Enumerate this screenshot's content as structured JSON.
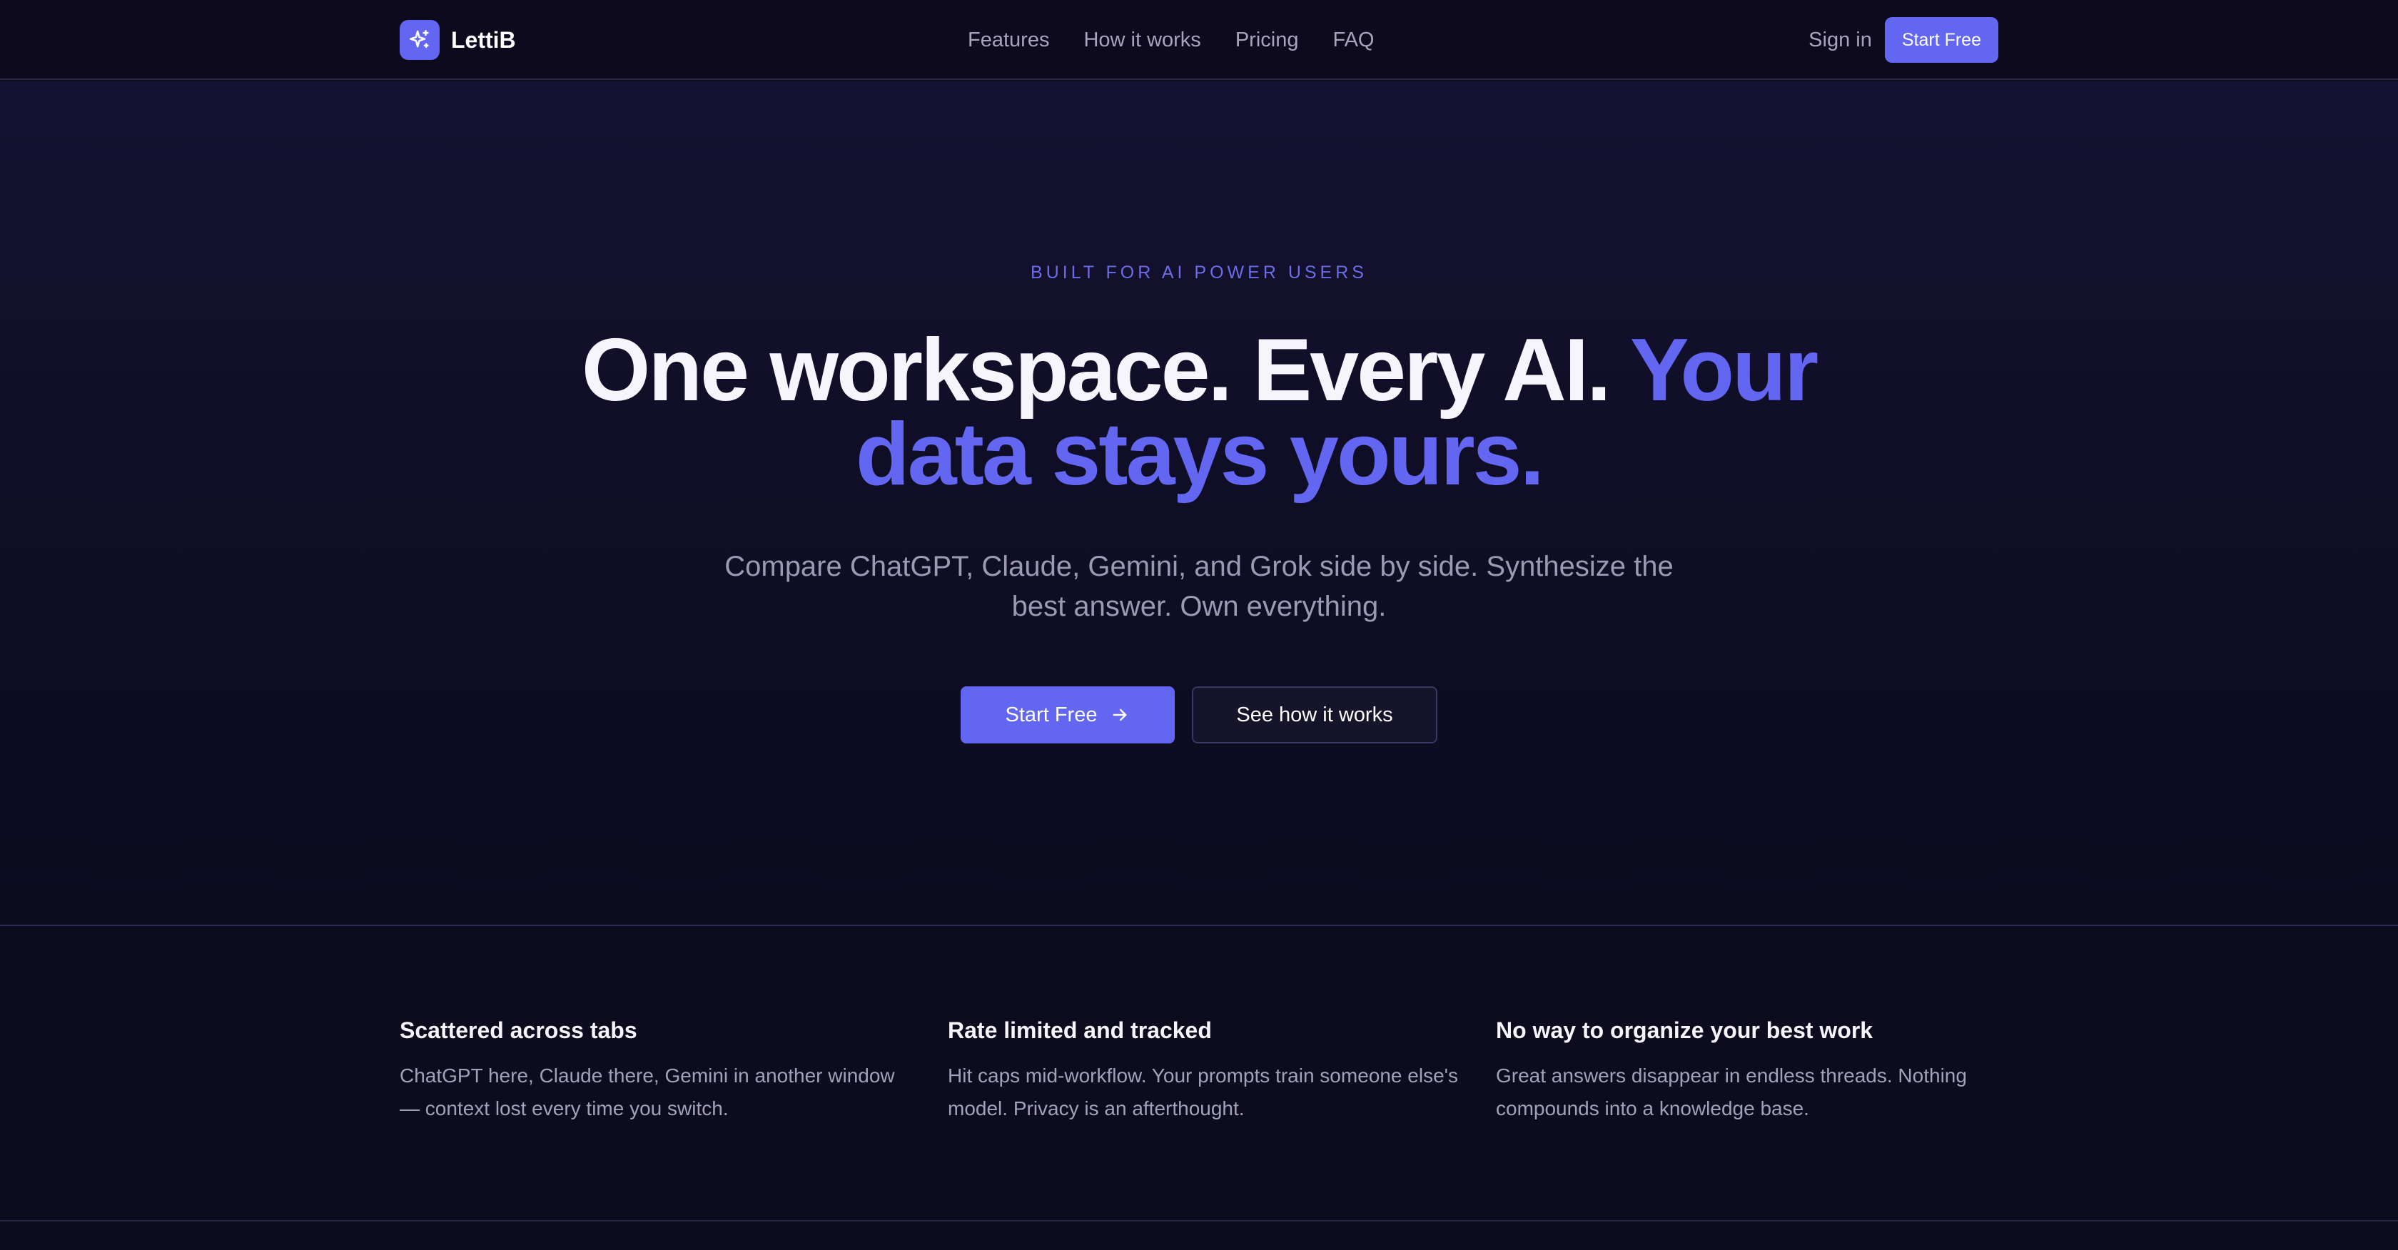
{
  "nav": {
    "brand": "LettiB",
    "links": [
      "Features",
      "How it works",
      "Pricing",
      "FAQ"
    ],
    "sign_in": "Sign in",
    "cta": "Start Free"
  },
  "hero": {
    "eyebrow": "BUILT FOR AI POWER USERS",
    "headline_main": "One workspace. Every AI.",
    "headline_accent": "Your data stays yours.",
    "subhead": "Compare ChatGPT, Claude, Gemini, and Grok side by side. Synthesize the best answer. Own everything.",
    "primary_cta": "Start Free",
    "secondary_cta": "See how it works"
  },
  "problems": [
    {
      "title": "Scattered across tabs",
      "body": "ChatGPT here, Claude there, Gemini in another window — context lost every time you switch."
    },
    {
      "title": "Rate limited and tracked",
      "body": "Hit caps mid-workflow. Your prompts train someone else's model. Privacy is an afterthought."
    },
    {
      "title": "No way to organize your best work",
      "body": "Great answers disappear in endless threads. Nothing compounds into a knowledge base."
    }
  ],
  "icons": {
    "brand": "sparkle-icon",
    "primary_cta": "arrow-right-icon"
  },
  "colors": {
    "accent": "#6366f1",
    "background": "#0d0b1e"
  }
}
